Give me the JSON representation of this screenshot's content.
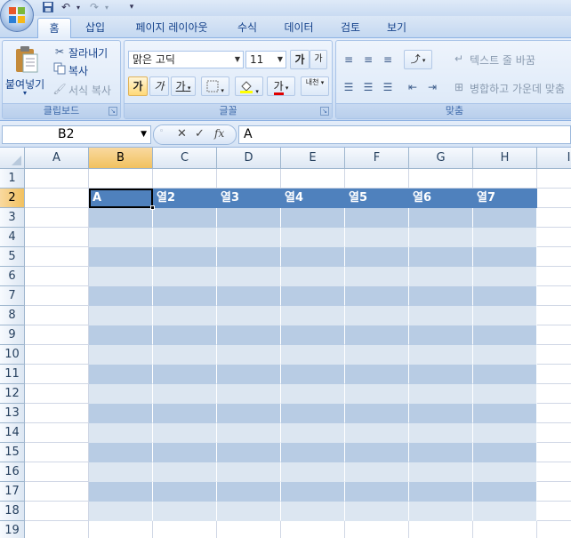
{
  "tabs": [
    {
      "label": "홈",
      "active": true
    },
    {
      "label": "삽입"
    },
    {
      "label": "페이지 레이아웃"
    },
    {
      "label": "수식"
    },
    {
      "label": "데이터"
    },
    {
      "label": "검토"
    },
    {
      "label": "보기"
    }
  ],
  "ribbon": {
    "clipboard": {
      "paste_label": "붙여넣기",
      "cut_label": "잘라내기",
      "copy_label": "복사",
      "format_painter_label": "서식 복사",
      "group_label": "클립보드"
    },
    "font": {
      "font_name": "맑은 고딕",
      "font_size": "11",
      "grow_label": "가",
      "shrink_label": "가",
      "bold_label": "가",
      "italic_label": "가",
      "underline_label": "가",
      "font_color_label": "가",
      "phonetic_label": "내천",
      "group_label": "글꼴"
    },
    "alignment": {
      "wrap_text_label": "텍스트 줄 바꿈",
      "merge_center_label": "병합하고 가운데 맞춤",
      "group_label": "맞춤"
    }
  },
  "formula_bar": {
    "name_box": "B2",
    "formula": "A"
  },
  "sheet": {
    "columns": [
      "A",
      "B",
      "C",
      "D",
      "E",
      "F",
      "G",
      "H",
      "I"
    ],
    "selected_column": "B",
    "rows": [
      "1",
      "2",
      "3",
      "4",
      "5",
      "6",
      "7",
      "8",
      "9",
      "10",
      "11",
      "12",
      "13",
      "14",
      "15",
      "16",
      "17",
      "18",
      "19"
    ],
    "selected_row": "2",
    "table_header": [
      "A",
      "열2",
      "열3",
      "열4",
      "열5",
      "열6",
      "열7"
    ],
    "active_cell": "B2"
  },
  "colors": {
    "table_header": "#4f81bd",
    "band_dark": "#b8cce4",
    "band_light": "#dce6f1",
    "selected_header": "#f1c15f"
  }
}
